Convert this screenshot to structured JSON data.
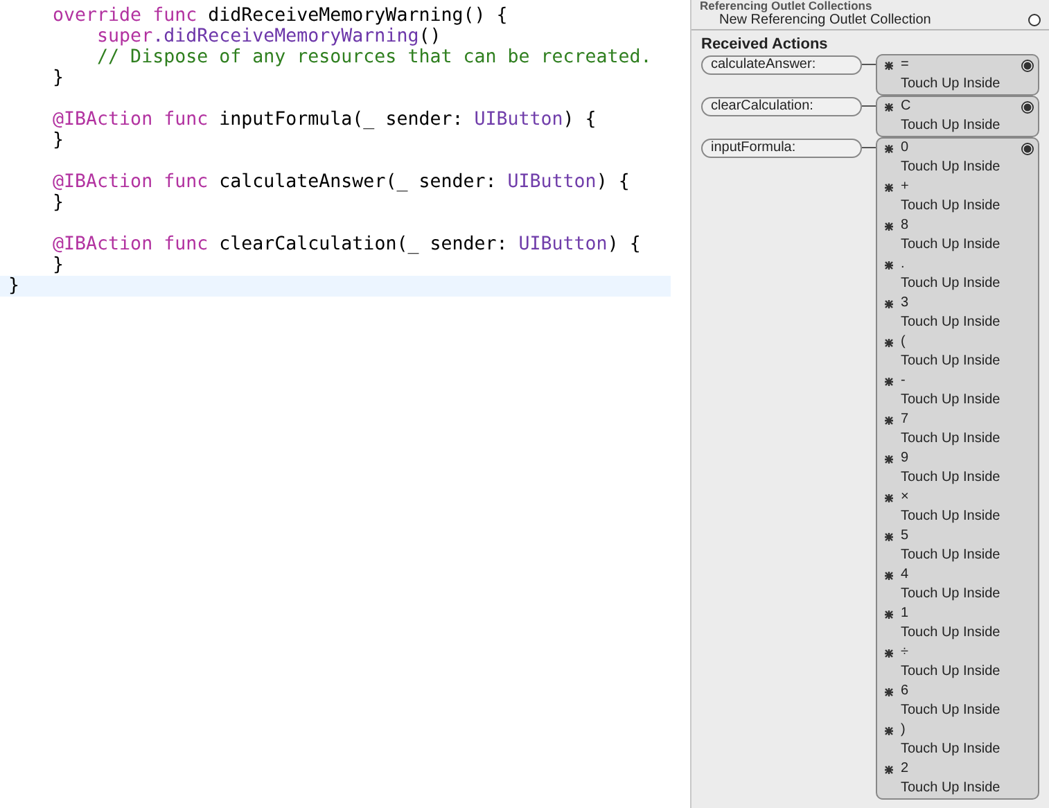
{
  "code": {
    "lines": [
      {
        "current": false,
        "tokens": [
          {
            "kind": "keyword",
            "text": "    override func"
          },
          {
            "kind": "plain",
            "text": " didReceiveMemoryWarning() {"
          }
        ]
      },
      {
        "current": false,
        "tokens": [
          {
            "kind": "keyword",
            "text": "        super"
          },
          {
            "kind": "call",
            "text": ".didReceiveMemoryWarning"
          },
          {
            "kind": "plain",
            "text": "()"
          }
        ]
      },
      {
        "current": false,
        "tokens": [
          {
            "kind": "comment",
            "text": "        // Dispose of any resources that can be recreated."
          }
        ]
      },
      {
        "current": false,
        "tokens": [
          {
            "kind": "plain",
            "text": "    }"
          }
        ]
      },
      {
        "current": false
      },
      {
        "current": false,
        "tokens": [
          {
            "kind": "keyword",
            "text": "    @IBAction func"
          },
          {
            "kind": "plain",
            "text": " inputFormula(_ sender: "
          },
          {
            "kind": "type",
            "text": "UIButton"
          },
          {
            "kind": "plain",
            "text": ") {"
          }
        ]
      },
      {
        "current": false,
        "tokens": [
          {
            "kind": "plain",
            "text": "    }"
          }
        ]
      },
      {
        "current": false
      },
      {
        "current": false,
        "tokens": [
          {
            "kind": "keyword",
            "text": "    @IBAction func"
          },
          {
            "kind": "plain",
            "text": " calculateAnswer(_ sender: "
          },
          {
            "kind": "type",
            "text": "UIButton"
          },
          {
            "kind": "plain",
            "text": ") {"
          }
        ]
      },
      {
        "current": false,
        "tokens": [
          {
            "kind": "plain",
            "text": "    }"
          }
        ]
      },
      {
        "current": false
      },
      {
        "current": false,
        "tokens": [
          {
            "kind": "keyword",
            "text": "    @IBAction func"
          },
          {
            "kind": "plain",
            "text": " clearCalculation(_ sender: "
          },
          {
            "kind": "type",
            "text": "UIButton"
          },
          {
            "kind": "plain",
            "text": ") {"
          }
        ]
      },
      {
        "current": false,
        "tokens": [
          {
            "kind": "plain",
            "text": "    }"
          }
        ]
      },
      {
        "current": true,
        "tokens": [
          {
            "kind": "plain",
            "text": "}"
          }
        ]
      }
    ]
  },
  "connections_panel": {
    "outlet_collections": {
      "heading": "Referencing Outlet Collections",
      "new_item": {
        "label": "New Referencing Outlet Collection",
        "connected": false
      }
    },
    "received_actions": {
      "heading": "Received Actions",
      "actions": [
        {
          "name": "calculateAnswer:",
          "connected": true,
          "connections": [
            {
              "sender": "=",
              "event": "Touch Up Inside"
            }
          ]
        },
        {
          "name": "clearCalculation:",
          "connected": true,
          "connections": [
            {
              "sender": "C",
              "event": "Touch Up Inside"
            }
          ]
        },
        {
          "name": "inputFormula:",
          "connected": true,
          "connections": [
            {
              "sender": "0",
              "event": "Touch Up Inside"
            },
            {
              "sender": "+",
              "event": "Touch Up Inside"
            },
            {
              "sender": "8",
              "event": "Touch Up Inside"
            },
            {
              "sender": ".",
              "event": "Touch Up Inside"
            },
            {
              "sender": "3",
              "event": "Touch Up Inside"
            },
            {
              "sender": "(",
              "event": "Touch Up Inside"
            },
            {
              "sender": "-",
              "event": "Touch Up Inside"
            },
            {
              "sender": "7",
              "event": "Touch Up Inside"
            },
            {
              "sender": "9",
              "event": "Touch Up Inside"
            },
            {
              "sender": "×",
              "event": "Touch Up Inside"
            },
            {
              "sender": "5",
              "event": "Touch Up Inside"
            },
            {
              "sender": "4",
              "event": "Touch Up Inside"
            },
            {
              "sender": "1",
              "event": "Touch Up Inside"
            },
            {
              "sender": "÷",
              "event": "Touch Up Inside"
            },
            {
              "sender": "6",
              "event": "Touch Up Inside"
            },
            {
              "sender": ")",
              "event": "Touch Up Inside"
            },
            {
              "sender": "2",
              "event": "Touch Up Inside"
            }
          ]
        }
      ]
    }
  }
}
